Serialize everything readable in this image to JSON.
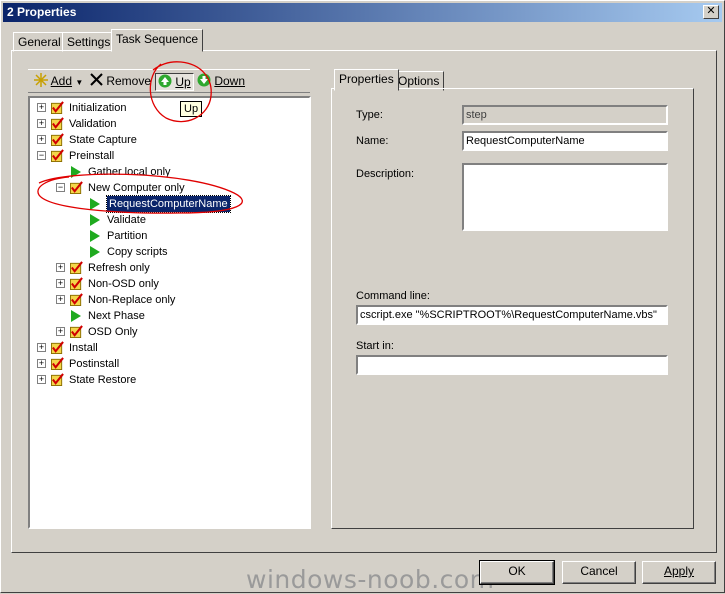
{
  "window": {
    "title": "2 Properties",
    "close_symbol": "✕"
  },
  "tabs": [
    {
      "label": "General",
      "active": false
    },
    {
      "label": "Settings",
      "active": false
    },
    {
      "label": "Task Sequence",
      "active": true
    }
  ],
  "toolbar": {
    "add_label": "Add",
    "remove_label": "Remove",
    "up_label": "Up",
    "down_label": "Down",
    "tooltip": "Up"
  },
  "tree": [
    {
      "label": "Initialization",
      "type": "group",
      "expander": "+"
    },
    {
      "label": "Validation",
      "type": "group",
      "expander": "+"
    },
    {
      "label": "State Capture",
      "type": "group",
      "expander": "+"
    },
    {
      "label": "Preinstall",
      "type": "group",
      "expander": "−"
    },
    {
      "label": "Gather local only",
      "type": "step"
    },
    {
      "label": "New Computer only",
      "type": "group",
      "expander": "−"
    },
    {
      "label": "RequestComputerName",
      "type": "step",
      "selected": true
    },
    {
      "label": "Validate",
      "type": "step"
    },
    {
      "label": "Partition",
      "type": "step"
    },
    {
      "label": "Copy scripts",
      "type": "step"
    },
    {
      "label": "Refresh only",
      "type": "group",
      "expander": "+"
    },
    {
      "label": "Non-OSD only",
      "type": "group",
      "expander": "+"
    },
    {
      "label": "Non-Replace only",
      "type": "group",
      "expander": "+"
    },
    {
      "label": "Next Phase",
      "type": "step"
    },
    {
      "label": "OSD Only",
      "type": "group",
      "expander": "+"
    },
    {
      "label": "Install",
      "type": "group",
      "expander": "+"
    },
    {
      "label": "Postinstall",
      "type": "group",
      "expander": "+"
    },
    {
      "label": "State Restore",
      "type": "group",
      "expander": "+"
    }
  ],
  "right_tabs": [
    {
      "label": "Properties",
      "active": true
    },
    {
      "label": "Options",
      "active": false
    }
  ],
  "properties": {
    "type_label": "Type:",
    "type_value": "step",
    "name_label": "Name:",
    "name_value": "RequestComputerName",
    "description_label": "Description:",
    "description_value": "",
    "command_label": "Command line:",
    "command_value": "cscript.exe \"%SCRIPTROOT%\\RequestComputerName.vbs\"",
    "startin_label": "Start in:",
    "startin_value": ""
  },
  "buttons": {
    "ok": "OK",
    "cancel": "Cancel",
    "apply": "Apply"
  },
  "watermark": "windows-noob.com",
  "colors": {
    "titlebar": "#0a246a",
    "selection": "#0a246a",
    "step_arrow": "#1faa1f",
    "annotation": "#e00000"
  }
}
